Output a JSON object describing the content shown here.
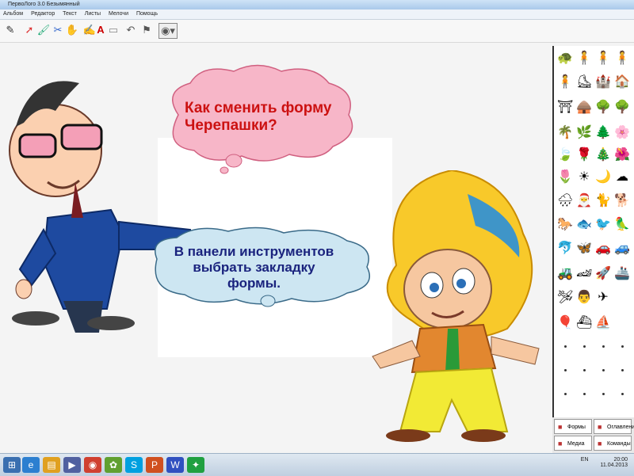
{
  "window": {
    "title": "ПервоЛого 3.0   Безымянный"
  },
  "menu": [
    "Альбом",
    "Редактор",
    "Текст",
    "Листы",
    "Мелочи",
    "Помощь"
  ],
  "bubbles": {
    "question_line1": "Как сменить форму",
    "question_line2": "Черепашки?",
    "answer_line1": "В панели инструментов",
    "answer_line2": "выбрать закладку",
    "answer_line3": "формы."
  },
  "palette_tabs": {
    "forms": "Формы",
    "contents": "Оглавление",
    "media": "Медиа",
    "commands": "Команды"
  },
  "taskbar": {
    "lang": "EN",
    "time": "20:00",
    "date": "11.04.2013"
  },
  "colors": {
    "question_text": "#cc1111",
    "answer_text": "#1a237e",
    "question_cloud": "#f7b6c8",
    "answer_cloud": "#cde6f2"
  }
}
